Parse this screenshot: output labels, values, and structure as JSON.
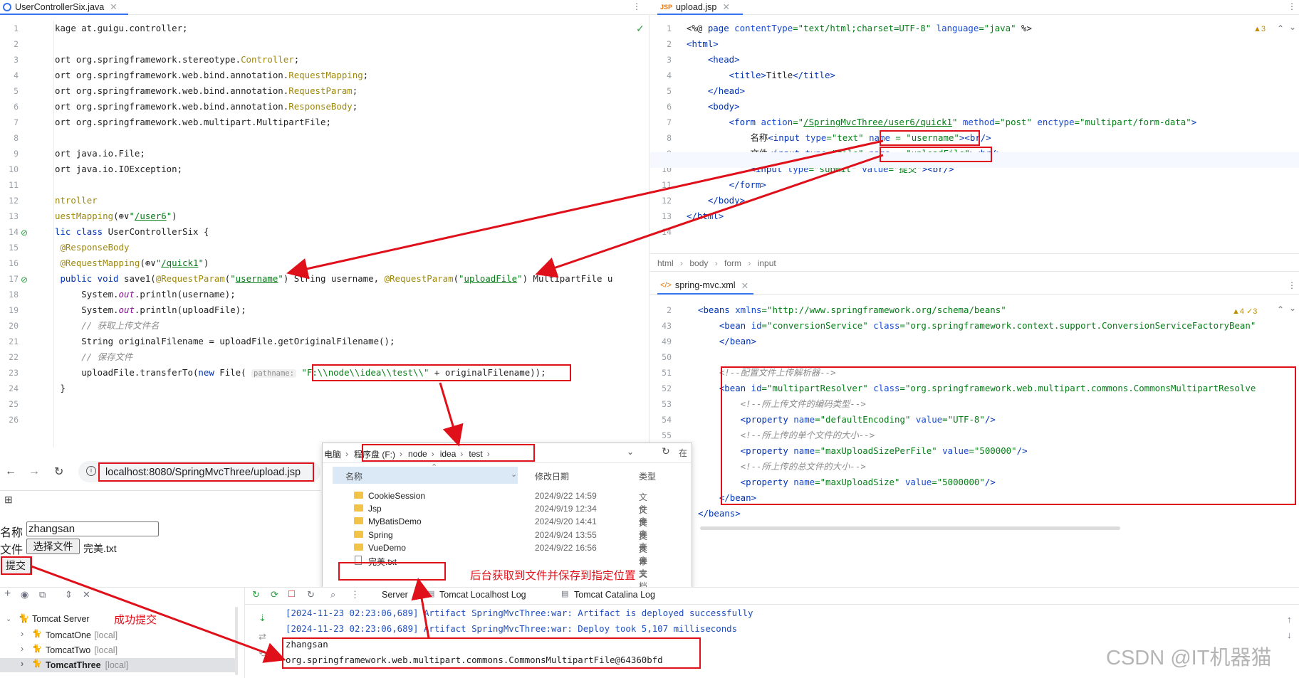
{
  "left_editor": {
    "tab_title": "UserControllerSix.java",
    "lines": [
      [
        "1",
        "<span>kage at.guigu.controller;</span>"
      ],
      [
        "2",
        ""
      ],
      [
        "3",
        "<span>ort org.springframework.stereotype.</span><span class=\"ann\">Controller</span><span>;</span>"
      ],
      [
        "4",
        "<span>ort org.springframework.web.bind.annotation.</span><span class=\"ann\">RequestMapping</span><span>;</span>"
      ],
      [
        "5",
        "<span>ort org.springframework.web.bind.annotation.</span><span class=\"ann\">RequestParam</span><span>;</span>"
      ],
      [
        "6",
        "<span>ort org.springframework.web.bind.annotation.</span><span class=\"ann\">ResponseBody</span><span>;</span>"
      ],
      [
        "7",
        "<span>ort org.springframework.web.multipart.MultipartFile;</span>"
      ],
      [
        "8",
        ""
      ],
      [
        "9",
        "<span>ort java.io.File;</span>"
      ],
      [
        "10",
        "<span>ort java.io.IOException;</span>"
      ],
      [
        "11",
        ""
      ],
      [
        "12",
        "<span class=\"ann\">ntroller</span>"
      ],
      [
        "13",
        "<span class=\"ann\">uestMapping</span><span>(⊕∨</span><span class=\"str\">\"<u>/user6</u>\"</span><span>)</span>"
      ],
      [
        "14",
        "<span class=\"kw\">lic class </span><span>UserControllerSix {</span>"
      ],
      [
        "15",
        "<span class=\"ann\"> @ResponseBody</span>"
      ],
      [
        "16",
        "<span class=\"ann\"> @RequestMapping</span><span>(⊕∨</span><span class=\"str\">\"<u>/quick1</u>\"</span><span>)</span>"
      ],
      [
        "17",
        "<span class=\"kw\"> public void </span><span>save1(</span><span class=\"ann\">@RequestParam</span><span>(</span><span class=\"str\">\"<u>username</u>\"</span><span>) String username, </span><span class=\"ann\">@RequestParam</span><span>(</span><span class=\"str\">\"<u>uploadFile</u>\"</span><span>) MultipartFile u</span>"
      ],
      [
        "18",
        "<span>     System.</span><span class=\"fld\">out</span><span>.println(username);</span>"
      ],
      [
        "19",
        "<span>     System.</span><span class=\"fld\">out</span><span>.println(uploadFile);</span>"
      ],
      [
        "20",
        "<span class=\"cmt\">     // 获取上传文件名</span>"
      ],
      [
        "21",
        "<span>     String originalFilename = uploadFile.getOriginalFilename();</span>"
      ],
      [
        "22",
        "<span class=\"cmt\">     // 保存文件</span>"
      ],
      [
        "23",
        "<span>     uploadFile.transferTo(</span><span class=\"kw\">new </span><span>File( </span><span class=\"hint\">pathname:</span><span> </span><span class=\"str\">\"F:\\\\node\\\\idea\\\\test\\\\\"</span><span> + originalFilename));</span>"
      ],
      [
        "24",
        "<span> }</span>"
      ],
      [
        "25",
        ""
      ],
      [
        "26",
        ""
      ]
    ]
  },
  "right_top_editor": {
    "tab_title": "upload.jsp",
    "warnings": "▲3",
    "lines": [
      [
        "1",
        "<span>&lt;%@ </span><span class=\"tag\">page </span><span class=\"attr\">contentType</span><span class=\"str\">=\"text/html;charset=UTF-8\"</span><span class=\"attr\"> language</span><span class=\"str\">=\"java\"</span><span> %&gt;</span>"
      ],
      [
        "2",
        "<span class=\"tag\">&lt;html&gt;</span>"
      ],
      [
        "3",
        "<span class=\"tag\">    &lt;head&gt;</span>"
      ],
      [
        "4",
        "<span class=\"tag\">        &lt;title&gt;</span><span>Title</span><span class=\"tag\">&lt;/title&gt;</span>"
      ],
      [
        "5",
        "<span class=\"tag\">    &lt;/head&gt;</span>"
      ],
      [
        "6",
        "<span class=\"tag\">    &lt;body&gt;</span>"
      ],
      [
        "7",
        "<span class=\"tag\">        &lt;form </span><span class=\"attr\">action</span><span class=\"str\">=\"<u>/SpringMvcThree/user6/quick1</u>\"</span><span class=\"attr\"> method</span><span class=\"str\">=\"post\"</span><span class=\"attr\"> enctype</span><span class=\"str\">=\"multipart/form-data\"</span><span class=\"tag\">&gt;</span>"
      ],
      [
        "8",
        "<span>            名称</span><span class=\"tag\">&lt;input </span><span class=\"attr\">type</span><span class=\"str\">=\"text\" </span><span class=\"attr\">name </span><span class=\"str\">= \"username\"</span><span class=\"tag\">&gt;&lt;br/&gt;</span>"
      ],
      [
        "9",
        "<span>            文件</span><span class=\"tag\">&lt;input </span><span class=\"attr\">type</span><span class=\"str\">=\"file\" </span><span class=\"attr\">name </span><span class=\"str\">= \"uploadFile\"</span><span class=\"tag\">&gt;&lt;br/&gt;</span>"
      ],
      [
        "10",
        "<span class=\"tag\">            &lt;input </span><span class=\"attr\">type</span><span class=\"str\">=\"submit\" </span><span class=\"attr\">value</span><span class=\"str\">=\"提交\"</span><span class=\"tag\">&gt;&lt;br/&gt;</span>"
      ],
      [
        "11",
        "<span class=\"tag\">        &lt;/form&gt;</span>"
      ],
      [
        "12",
        "<span class=\"tag\">    &lt;/body&gt;</span>"
      ],
      [
        "13",
        "<span class=\"tag\">&lt;/html&gt;</span>"
      ],
      [
        "14",
        ""
      ]
    ],
    "breadcrumb": [
      "html",
      "body",
      "form",
      "input"
    ]
  },
  "right_bottom_editor": {
    "tab_title": "spring-mvc.xml",
    "warnings": "▲4 ✓3",
    "lines": [
      [
        "2",
        "<span class=\"tag\">&lt;beans </span><span class=\"attr\">xmlns</span><span class=\"str\">=\"http://www.springframework.org/schema/beans\"</span>"
      ],
      [
        "43",
        "<span class=\"tag\">    &lt;bean </span><span class=\"attr\">id</span><span class=\"str\">=\"conversionService\"</span><span class=\"attr\"> class</span><span class=\"str\">=\"org.springframework.context.support.ConversionServiceFactoryBean\"</span>"
      ],
      [
        "49",
        "<span class=\"tag\">    &lt;/bean&gt;</span>"
      ],
      [
        "50",
        ""
      ],
      [
        "51",
        "<span class=\"cmt\">    &lt;!--配置文件上传解析器--&gt;</span>"
      ],
      [
        "52",
        "<span class=\"tag\">    &lt;bean </span><span class=\"attr\">id</span><span class=\"str\">=\"multipartResolver\"</span><span class=\"attr\"> class</span><span class=\"str\">=\"org.springframework.web.multipart.commons.CommonsMultipartResolve</span>"
      ],
      [
        "53",
        "<span class=\"cmt\">        &lt;!--所上传文件的编码类型--&gt;</span>"
      ],
      [
        "54",
        "<span class=\"tag\">        &lt;property </span><span class=\"attr\">name</span><span class=\"str\">=\"defaultEncoding\"</span><span class=\"attr\"> value</span><span class=\"str\">=\"UTF-8\"</span><span class=\"tag\">/&gt;</span>"
      ],
      [
        "55",
        "<span class=\"cmt\">        &lt;!--所上传的单个文件的大小--&gt;</span>"
      ],
      [
        "56",
        "<span class=\"tag\">        &lt;property </span><span class=\"attr\">name</span><span class=\"str\">=\"maxUploadSizePerFile\"</span><span class=\"attr\"> value</span><span class=\"str\">=\"500000\"</span><span class=\"tag\">/&gt;</span>"
      ],
      [
        "57",
        "<span class=\"cmt\">        &lt;!--所上传的总文件的大小--&gt;</span>"
      ],
      [
        "58",
        "<span class=\"tag\">        &lt;property </span><span class=\"attr\">name</span><span class=\"str\">=\"maxUploadSize\"</span><span class=\"attr\"> value</span><span class=\"str\">=\"5000000\"</span><span class=\"tag\">/&gt;</span>"
      ],
      [
        "59",
        "<span class=\"tag\">    &lt;/bean&gt;</span>"
      ],
      [
        "60",
        "<span class=\"tag\">&lt;/beans&gt;</span>"
      ]
    ]
  },
  "browser": {
    "url": "localhost:8080/SpringMvcThree/upload.jsp",
    "name_label": "名称",
    "name_value": "zhangsan",
    "file_label": "文件",
    "choose_file_button": "选择文件",
    "chosen_file": "完美.txt",
    "submit_button": "提交"
  },
  "file_explorer": {
    "path": [
      "电脑",
      "程序盘 (F:)",
      "node",
      "idea",
      "test"
    ],
    "columns": [
      "名称",
      "修改日期",
      "类型"
    ],
    "rows": [
      {
        "name": "CookieSession",
        "date": "2024/9/22 14:59",
        "type": "文件夹"
      },
      {
        "name": "Jsp",
        "date": "2024/9/19 12:34",
        "type": "文件夹"
      },
      {
        "name": "MyBatisDemo",
        "date": "2024/9/20 14:41",
        "type": "文件夹"
      },
      {
        "name": "Spring",
        "date": "2024/9/24 13:55",
        "type": "文件夹"
      },
      {
        "name": "VueDemo",
        "date": "2024/9/22 16:56",
        "type": "文件夹"
      },
      {
        "name": "完美.txt",
        "date": "",
        "type": "本文档"
      }
    ]
  },
  "services": {
    "server_root": "Tomcat Server",
    "servers": [
      {
        "name": "TomcatOne",
        "tag": "[local]"
      },
      {
        "name": "TomcatTwo",
        "tag": "[local]"
      },
      {
        "name": "TomcatThree",
        "tag": "[local]"
      }
    ],
    "tabs": [
      "Server",
      "Tomcat Localhost Log",
      "Tomcat Catalina Log"
    ],
    "console": [
      "[2024-11-23 02:23:06,689] Artifact SpringMvcThree:war: Artifact is deployed successfully",
      "[2024-11-23 02:23:06,689] Artifact SpringMvcThree:war: Deploy took 5,107 milliseconds",
      "zhangsan",
      "org.springframework.web.multipart.commons.CommonsMultipartFile@64360bfd"
    ]
  },
  "annotations": {
    "saved_note": "后台获取到文件并保存到指定位置",
    "submit_note": "成功提交"
  },
  "watermark": "CSDN @IT机器猫"
}
